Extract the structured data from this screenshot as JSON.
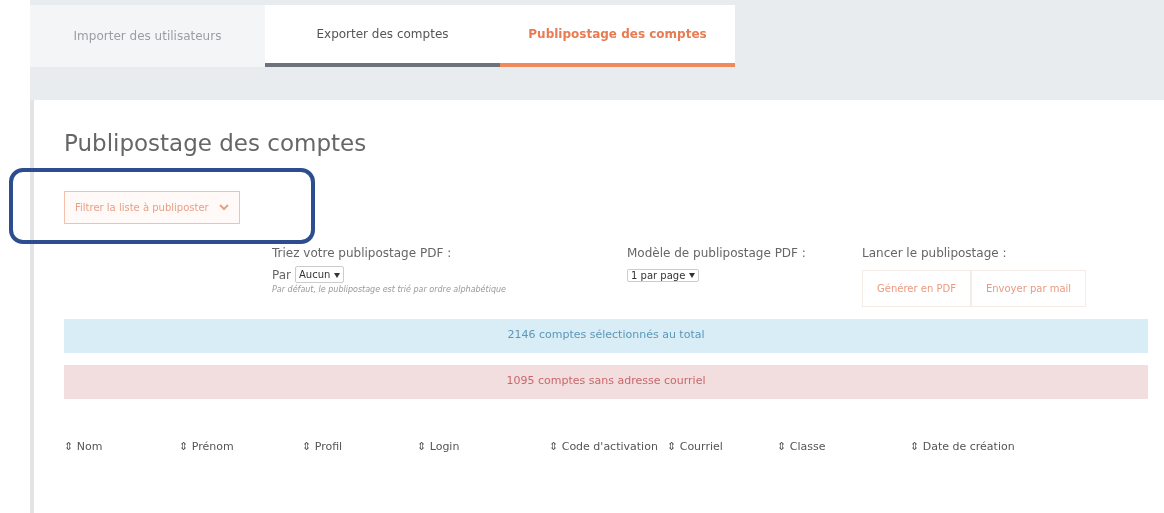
{
  "tabs": [
    {
      "label": "Importer des utilisateurs",
      "selected": false,
      "disabled": true,
      "underline": false
    },
    {
      "label": "Exporter des comptes",
      "selected": false,
      "disabled": false,
      "underline": true
    },
    {
      "label": "Publipostage des comptes",
      "selected": true,
      "disabled": false,
      "underline": true
    }
  ],
  "title": "Publipostage des comptes",
  "filter_button": {
    "label": "Filtrer la liste à publiposter",
    "highlighted": true
  },
  "sort": {
    "label": "Triez votre publipostage PDF :",
    "prefix": "Par",
    "value": "Aucun",
    "note": "Par défaut, le publipostage est trié par ordre alphabétique"
  },
  "template": {
    "label": "Modèle de publipostage PDF :",
    "value": "1 par page"
  },
  "launch": {
    "label": "Lancer le publipostage :",
    "buttons": [
      "Générer en PDF",
      "Envoyer par mail"
    ]
  },
  "alerts": [
    {
      "kind": "info",
      "text": "2146 comptes sélectionnés au total"
    },
    {
      "kind": "danger",
      "text": "1095 comptes sans adresse courriel"
    }
  ],
  "table": {
    "columns": [
      "Nom",
      "Prénom",
      "Profil",
      "Login",
      "Code d'activation",
      "Courriel",
      "Classe",
      "Date de création"
    ],
    "sort_icon": "⇕"
  }
}
